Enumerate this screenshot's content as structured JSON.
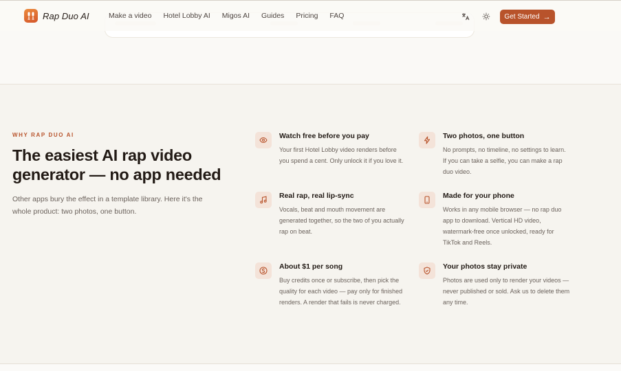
{
  "nav": {
    "brand": "Rap Duo AI",
    "links": [
      "Make a video",
      "Hotel Lobby AI",
      "Migos AI",
      "Guides",
      "Pricing",
      "FAQ"
    ],
    "translate_icon": "translate-icon",
    "theme_icon": "sun-icon",
    "cta_label": "Get Started",
    "cta_icon": "arrow-right-icon"
  },
  "colors": {
    "accent": "#b8532b",
    "icon_bg": "#f4e3d9",
    "page_bg": "#f6f4ef"
  },
  "section": {
    "eyebrow": "WHY RAP DUO AI",
    "headline": "The easiest AI rap video generator — no app needed",
    "subtext": "Other apps bury the effect in a template library. Here it's the whole product: two photos, one button."
  },
  "features": [
    {
      "icon": "eye-icon",
      "title": "Watch free before you pay",
      "desc": "Your first Hotel Lobby video renders before you spend a cent. Only unlock it if you love it."
    },
    {
      "icon": "lightning-icon",
      "title": "Two photos, one button",
      "desc": "No prompts, no timeline, no settings to learn. If you can take a selfie, you can make a rap duo video."
    },
    {
      "icon": "music-note-icon",
      "title": "Real rap, real lip-sync",
      "desc": "Vocals, beat and mouth movement are generated together, so the two of you actually rap on beat."
    },
    {
      "icon": "phone-icon",
      "title": "Made for your phone",
      "desc": "Works in any mobile browser — no rap duo app to download. Vertical HD video, watermark-free once unlocked, ready for TikTok and Reels."
    },
    {
      "icon": "dollar-icon",
      "title": "About $1 per song",
      "desc": "Buy credits once or subscribe, then pick the quality for each video — pay only for finished renders. A render that fails is never charged."
    },
    {
      "icon": "shield-check-icon",
      "title": "Your photos stay private",
      "desc": "Photos are used only to render your videos — never published or sold. Ask us to delete them any time."
    }
  ]
}
